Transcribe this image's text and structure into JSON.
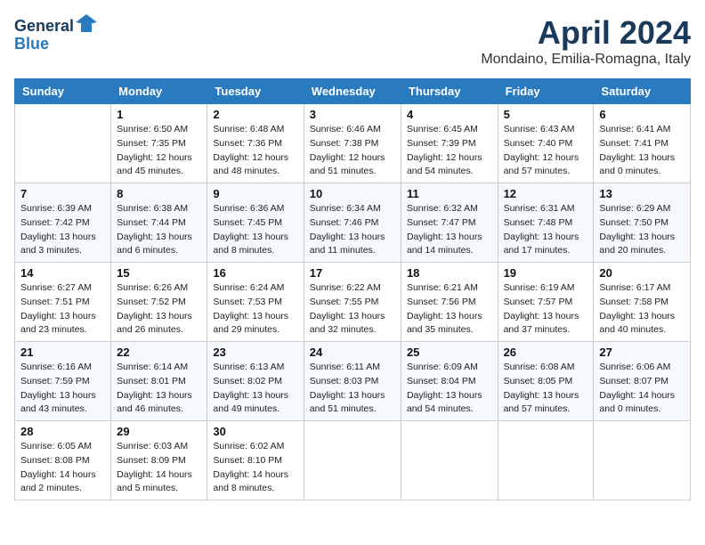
{
  "header": {
    "logo": {
      "line1": "General",
      "line2": "Blue",
      "bird_symbol": "🔷"
    },
    "title": "April 2024",
    "subtitle": "Mondaino, Emilia-Romagna, Italy"
  },
  "calendar": {
    "days_of_week": [
      "Sunday",
      "Monday",
      "Tuesday",
      "Wednesday",
      "Thursday",
      "Friday",
      "Saturday"
    ],
    "weeks": [
      [
        {
          "day": "",
          "info": ""
        },
        {
          "day": "1",
          "info": "Sunrise: 6:50 AM\nSunset: 7:35 PM\nDaylight: 12 hours\nand 45 minutes."
        },
        {
          "day": "2",
          "info": "Sunrise: 6:48 AM\nSunset: 7:36 PM\nDaylight: 12 hours\nand 48 minutes."
        },
        {
          "day": "3",
          "info": "Sunrise: 6:46 AM\nSunset: 7:38 PM\nDaylight: 12 hours\nand 51 minutes."
        },
        {
          "day": "4",
          "info": "Sunrise: 6:45 AM\nSunset: 7:39 PM\nDaylight: 12 hours\nand 54 minutes."
        },
        {
          "day": "5",
          "info": "Sunrise: 6:43 AM\nSunset: 7:40 PM\nDaylight: 12 hours\nand 57 minutes."
        },
        {
          "day": "6",
          "info": "Sunrise: 6:41 AM\nSunset: 7:41 PM\nDaylight: 13 hours\nand 0 minutes."
        }
      ],
      [
        {
          "day": "7",
          "info": "Sunrise: 6:39 AM\nSunset: 7:42 PM\nDaylight: 13 hours\nand 3 minutes."
        },
        {
          "day": "8",
          "info": "Sunrise: 6:38 AM\nSunset: 7:44 PM\nDaylight: 13 hours\nand 6 minutes."
        },
        {
          "day": "9",
          "info": "Sunrise: 6:36 AM\nSunset: 7:45 PM\nDaylight: 13 hours\nand 8 minutes."
        },
        {
          "day": "10",
          "info": "Sunrise: 6:34 AM\nSunset: 7:46 PM\nDaylight: 13 hours\nand 11 minutes."
        },
        {
          "day": "11",
          "info": "Sunrise: 6:32 AM\nSunset: 7:47 PM\nDaylight: 13 hours\nand 14 minutes."
        },
        {
          "day": "12",
          "info": "Sunrise: 6:31 AM\nSunset: 7:48 PM\nDaylight: 13 hours\nand 17 minutes."
        },
        {
          "day": "13",
          "info": "Sunrise: 6:29 AM\nSunset: 7:50 PM\nDaylight: 13 hours\nand 20 minutes."
        }
      ],
      [
        {
          "day": "14",
          "info": "Sunrise: 6:27 AM\nSunset: 7:51 PM\nDaylight: 13 hours\nand 23 minutes."
        },
        {
          "day": "15",
          "info": "Sunrise: 6:26 AM\nSunset: 7:52 PM\nDaylight: 13 hours\nand 26 minutes."
        },
        {
          "day": "16",
          "info": "Sunrise: 6:24 AM\nSunset: 7:53 PM\nDaylight: 13 hours\nand 29 minutes."
        },
        {
          "day": "17",
          "info": "Sunrise: 6:22 AM\nSunset: 7:55 PM\nDaylight: 13 hours\nand 32 minutes."
        },
        {
          "day": "18",
          "info": "Sunrise: 6:21 AM\nSunset: 7:56 PM\nDaylight: 13 hours\nand 35 minutes."
        },
        {
          "day": "19",
          "info": "Sunrise: 6:19 AM\nSunset: 7:57 PM\nDaylight: 13 hours\nand 37 minutes."
        },
        {
          "day": "20",
          "info": "Sunrise: 6:17 AM\nSunset: 7:58 PM\nDaylight: 13 hours\nand 40 minutes."
        }
      ],
      [
        {
          "day": "21",
          "info": "Sunrise: 6:16 AM\nSunset: 7:59 PM\nDaylight: 13 hours\nand 43 minutes."
        },
        {
          "day": "22",
          "info": "Sunrise: 6:14 AM\nSunset: 8:01 PM\nDaylight: 13 hours\nand 46 minutes."
        },
        {
          "day": "23",
          "info": "Sunrise: 6:13 AM\nSunset: 8:02 PM\nDaylight: 13 hours\nand 49 minutes."
        },
        {
          "day": "24",
          "info": "Sunrise: 6:11 AM\nSunset: 8:03 PM\nDaylight: 13 hours\nand 51 minutes."
        },
        {
          "day": "25",
          "info": "Sunrise: 6:09 AM\nSunset: 8:04 PM\nDaylight: 13 hours\nand 54 minutes."
        },
        {
          "day": "26",
          "info": "Sunrise: 6:08 AM\nSunset: 8:05 PM\nDaylight: 13 hours\nand 57 minutes."
        },
        {
          "day": "27",
          "info": "Sunrise: 6:06 AM\nSunset: 8:07 PM\nDaylight: 14 hours\nand 0 minutes."
        }
      ],
      [
        {
          "day": "28",
          "info": "Sunrise: 6:05 AM\nSunset: 8:08 PM\nDaylight: 14 hours\nand 2 minutes."
        },
        {
          "day": "29",
          "info": "Sunrise: 6:03 AM\nSunset: 8:09 PM\nDaylight: 14 hours\nand 5 minutes."
        },
        {
          "day": "30",
          "info": "Sunrise: 6:02 AM\nSunset: 8:10 PM\nDaylight: 14 hours\nand 8 minutes."
        },
        {
          "day": "",
          "info": ""
        },
        {
          "day": "",
          "info": ""
        },
        {
          "day": "",
          "info": ""
        },
        {
          "day": "",
          "info": ""
        }
      ]
    ]
  }
}
